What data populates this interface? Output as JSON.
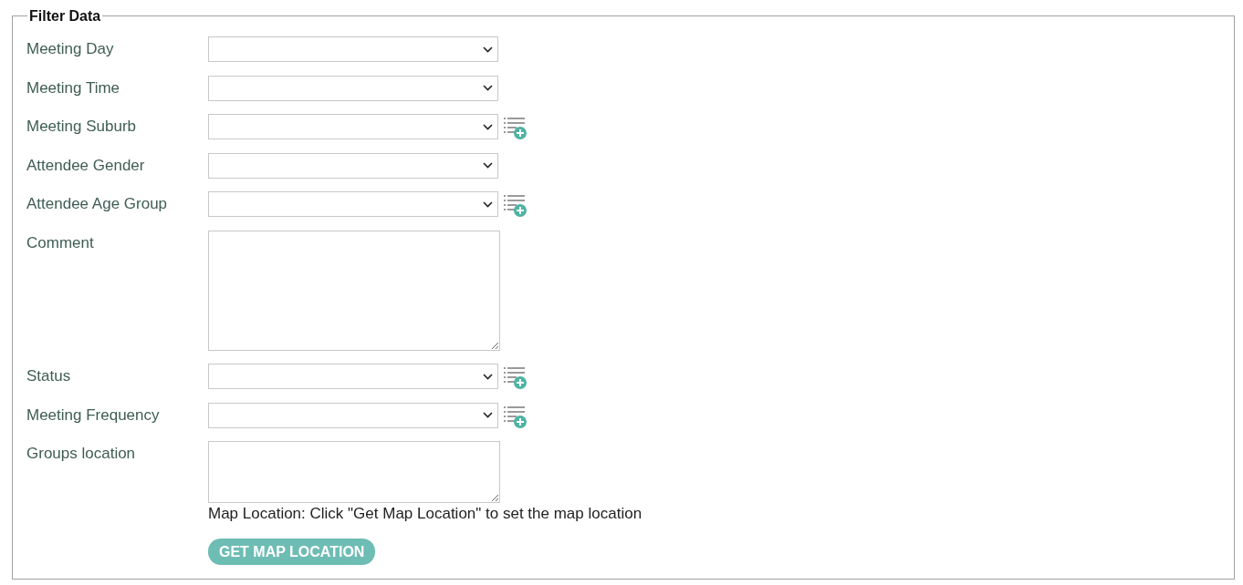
{
  "legend": "Filter Data",
  "fields": [
    {
      "label": "Meeting Day",
      "kind": "select",
      "add_icon": false
    },
    {
      "label": "Meeting Time",
      "kind": "select",
      "add_icon": false
    },
    {
      "label": "Meeting Suburb",
      "kind": "select",
      "add_icon": true
    },
    {
      "label": "Attendee Gender",
      "kind": "select",
      "add_icon": false
    },
    {
      "label": "Attendee Age Group",
      "kind": "select",
      "add_icon": true
    },
    {
      "label": "Comment",
      "kind": "textarea"
    },
    {
      "label": "Status",
      "kind": "select",
      "add_icon": true
    },
    {
      "label": "Meeting Frequency",
      "kind": "select",
      "add_icon": true
    },
    {
      "label": "Groups location",
      "kind": "location",
      "note": "Map Location: Click \"Get Map Location\" to set the map location",
      "button": "GET MAP LOCATION"
    }
  ]
}
